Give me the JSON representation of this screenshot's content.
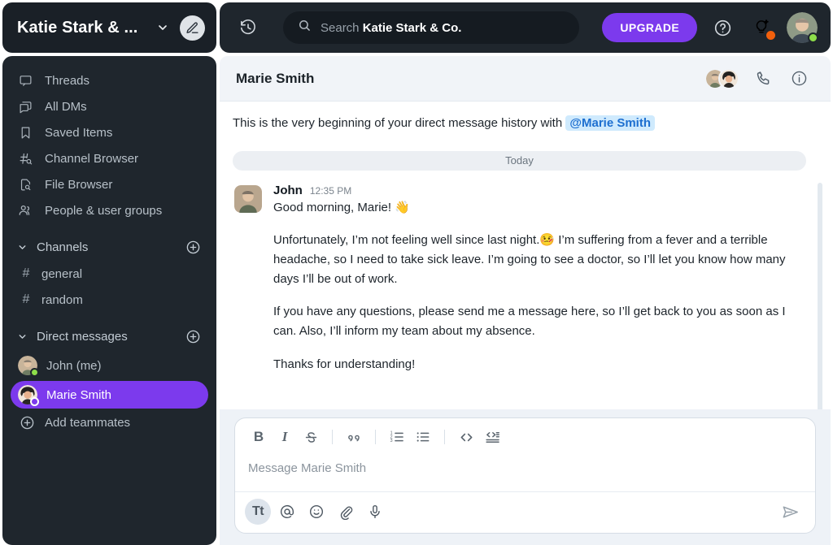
{
  "workspace": {
    "name": "Katie Stark & ...",
    "chevron_icon": "chevron-down-icon",
    "compose_icon": "pencil-icon"
  },
  "sidebar": {
    "nav_items": [
      {
        "label": "Threads",
        "icon": "threads-icon"
      },
      {
        "label": "All DMs",
        "icon": "all-dms-icon"
      },
      {
        "label": "Saved Items",
        "icon": "bookmark-icon"
      },
      {
        "label": "Channel Browser",
        "icon": "channel-browser-icon"
      },
      {
        "label": "File Browser",
        "icon": "file-browser-icon"
      },
      {
        "label": "People & user groups",
        "icon": "people-icon"
      }
    ],
    "channels_section": {
      "title": "Channels",
      "add_label": "+",
      "items": [
        {
          "name": "general",
          "prefix": "#"
        },
        {
          "name": "random",
          "prefix": "#"
        }
      ]
    },
    "dm_section": {
      "title": "Direct messages",
      "add_label": "+",
      "items": [
        {
          "name": "John (me)",
          "status": "online",
          "active": false
        },
        {
          "name": "Marie Smith",
          "status": "offline",
          "active": true
        }
      ],
      "add_teammates_label": "Add teammates"
    }
  },
  "topbar": {
    "history_icon": "history-clock-icon",
    "search_prefix": "Search",
    "search_workspace": "Katie Stark & Co.",
    "search_icon": "search-icon",
    "upgrade_label": "UPGRADE",
    "help_icon": "help-circle-icon",
    "whats_new_icon": "lightbulb-icon",
    "notification_color": "#f2600c",
    "avatar_status": "online"
  },
  "conversation": {
    "title": "Marie Smith",
    "call_icon": "phone-icon",
    "info_icon": "info-circle-icon",
    "intro_text": "This is the very beginning of your direct message history with",
    "intro_mention": "@Marie Smith",
    "day_divider": "Today",
    "message": {
      "author": "John",
      "time": "12:35 PM",
      "paragraphs": [
        "Good morning, Marie! 👋",
        "Unfortunately, I’m not feeling well since last night.🤒 I’m suffering from a fever and a terrible headache, so I need to take sick leave. I’m going to see a doctor, so I’ll let you know how many days I’ll be out of work.",
        "If you have any questions, please send me a message here, so I’ll get back to you as soon as I can. Also, I’ll inform my team about my absence.",
        "Thanks for understanding!"
      ]
    }
  },
  "composer": {
    "placeholder": "Message Marie Smith",
    "format_buttons": [
      {
        "label": "B",
        "name": "bold-button"
      },
      {
        "label": "I",
        "name": "italic-button"
      },
      {
        "label": "S",
        "name": "strikethrough-button"
      },
      {
        "label": "❝",
        "name": "blockquote-button"
      },
      {
        "label": "1.",
        "name": "ordered-list-button"
      },
      {
        "label": "•",
        "name": "bullet-list-button"
      },
      {
        "label": "<>",
        "name": "inline-code-button"
      },
      {
        "label": "code",
        "name": "code-block-button"
      }
    ],
    "action_buttons": [
      {
        "label": "Tt",
        "name": "formatting-toggle"
      },
      {
        "label": "@",
        "name": "mention-button"
      },
      {
        "label": "☺",
        "name": "emoji-button"
      },
      {
        "label": "📎",
        "name": "attachment-button"
      },
      {
        "label": "🎤",
        "name": "voice-button"
      }
    ],
    "send_icon": "send-icon"
  },
  "colors": {
    "accent_purple": "#7c3aed",
    "sidebar_dark": "#1f262d",
    "header_dark": "#1a2027",
    "online_green": "#8ede4a",
    "mention_blue": "#cfeafd"
  }
}
